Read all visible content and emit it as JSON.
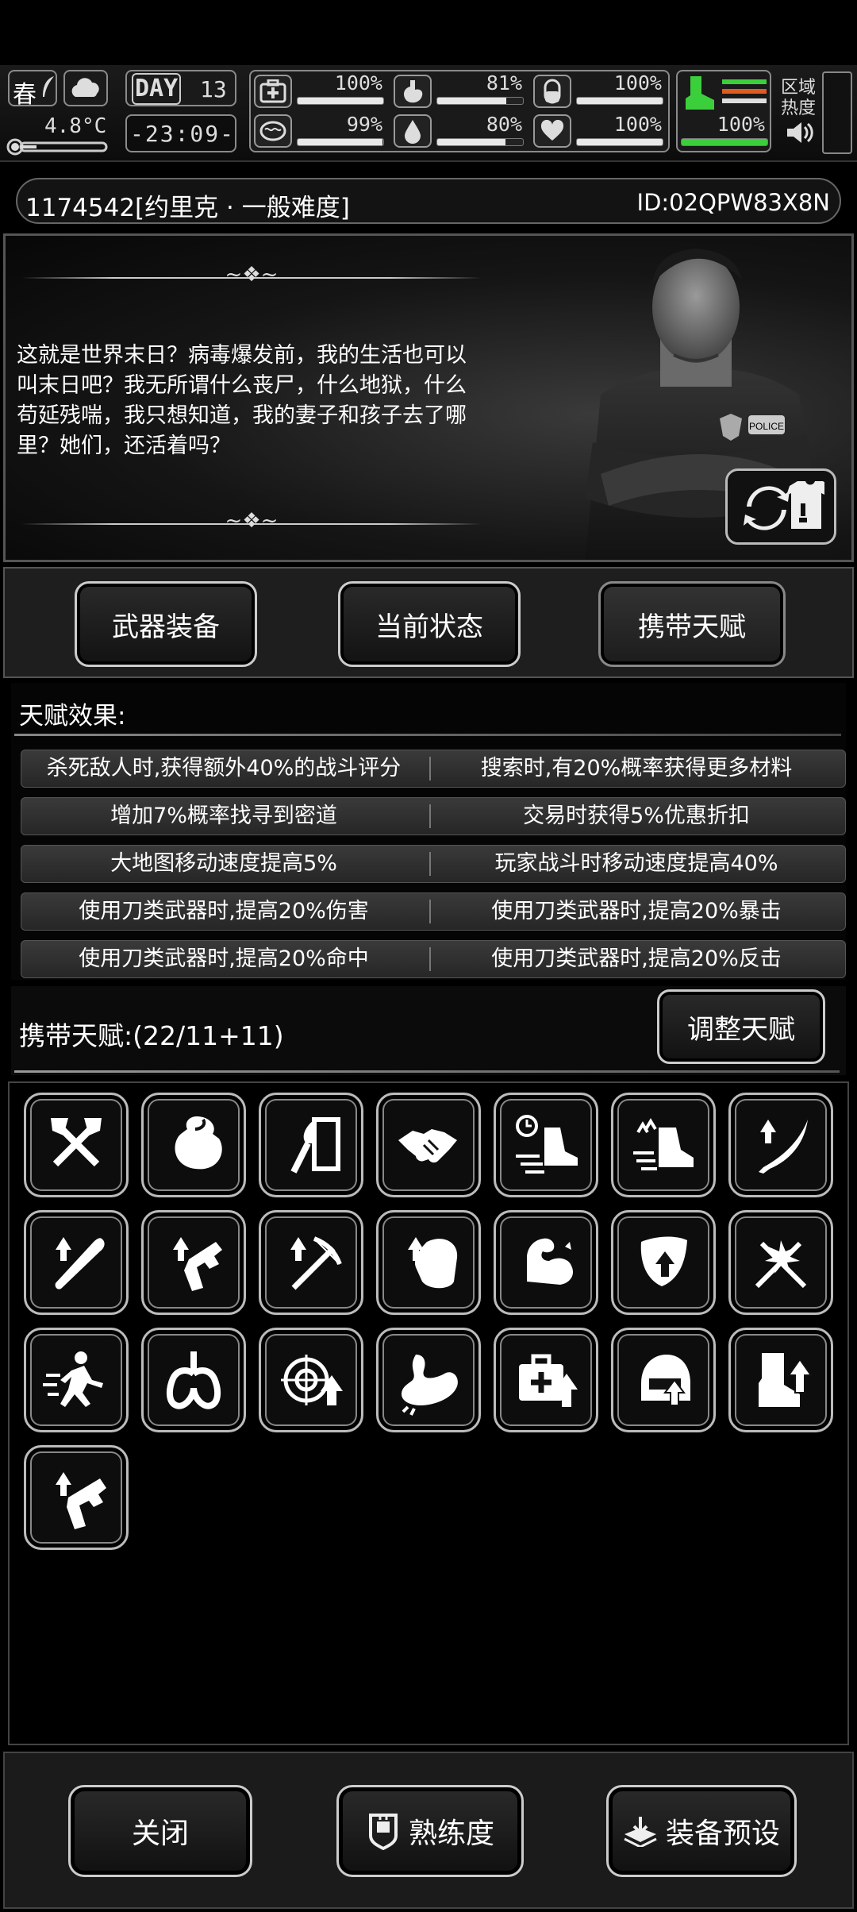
{
  "status_bar": {
    "season": "春",
    "temperature": "4.8°C",
    "day_label": "DAY",
    "day_number": "13",
    "clock": "-23:09-",
    "stats_left": [
      {
        "icon": "first-aid-icon",
        "value": "100%",
        "level": 1.0
      },
      {
        "icon": "brain-icon",
        "value": "99%",
        "level": 0.99
      }
    ],
    "stats_mid": [
      {
        "icon": "stomach-icon",
        "value": "81%",
        "level": 0.81
      },
      {
        "icon": "water-drop-icon",
        "value": "80%",
        "level": 0.8
      }
    ],
    "stats_right": [
      {
        "icon": "pill-icon",
        "value": "100%",
        "level": 1.0
      },
      {
        "icon": "heart-icon",
        "value": "100%",
        "level": 1.0
      }
    ],
    "stamina_value": "100%",
    "stamina_level": 1.0,
    "stamina_color": "#3ccf3c",
    "region_heat_label": "区域\n热度"
  },
  "player": {
    "name": "1174542[约里克 · 一般难度]",
    "id": "ID:02QPW83X8N"
  },
  "character": {
    "quote": "这就是世界末日？病毒爆发前，我的生活也可以叫末日吧？我无所谓什么丧尸，什么地狱，什么苟延残喘，我只想知道，我的妻子和孩子去了哪里？她们，还活着吗？",
    "badge_text": "POLICE"
  },
  "tabs": [
    "武器装备",
    "当前状态",
    "携带天赋"
  ],
  "effects": {
    "title": "天赋效果:",
    "rows": [
      [
        "杀死敌人时,获得额外40%的战斗评分",
        "搜索时,有20%概率获得更多材料"
      ],
      [
        "增加7%概率找寻到密道",
        "交易时获得5%优惠折扣"
      ],
      [
        "大地图移动速度提高5%",
        "玩家战斗时移动速度提高40%"
      ],
      [
        "使用刀类武器时,提高20%伤害",
        "使用刀类武器时,提高20%暴击"
      ],
      [
        "使用刀类武器时,提高20%命中",
        "使用刀类武器时,提高20%反击"
      ]
    ]
  },
  "carry": {
    "title": "携带天赋:(22/11+11)",
    "adjust_label": "调整天赋"
  },
  "talents": [
    "crossed-axes-icon",
    "loot-bag-icon",
    "door-torch-icon",
    "handshake-icon",
    "timed-speed-icon",
    "speed-boost-icon",
    "blade-up-icon",
    "bat-up-icon",
    "pistol-up-icon",
    "crossbow-up-icon",
    "fist-up-icon",
    "muscle-icon",
    "shield-up-icon",
    "crossed-swords-icon",
    "sprint-icon",
    "lungs-icon",
    "target-up-icon",
    "stomach-arm-icon",
    "medkit-up-icon",
    "helmet-up-icon",
    "boot-up-icon",
    "pistol-up-alt-icon"
  ],
  "bottom": {
    "close_label": "关闭",
    "proficiency_label": "熟练度",
    "preset_label": "装备预设"
  }
}
